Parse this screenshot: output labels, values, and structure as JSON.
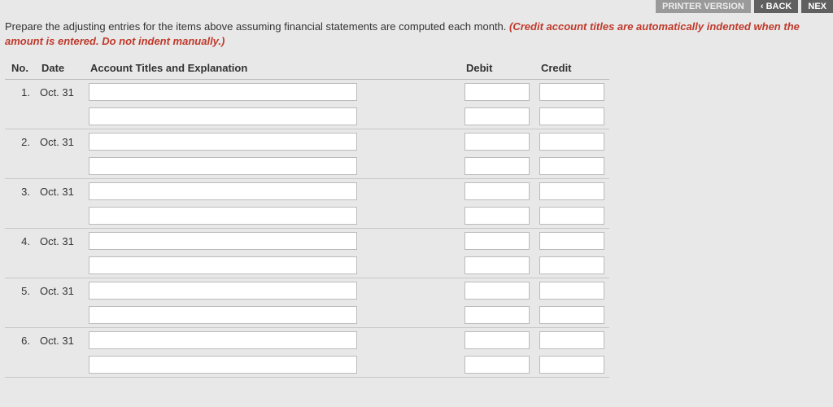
{
  "topbar": {
    "printer_label": "PRINTER VERSION",
    "back_label": "‹ BACK",
    "next_label": "NEX"
  },
  "instructions": {
    "plain": "Prepare the adjusting entries for the items above assuming financial statements are computed each month. ",
    "emph": "(Credit account titles are automatically indented when the amount is entered. Do not indent manually.)"
  },
  "headers": {
    "no": "No.",
    "date": "Date",
    "account": "Account Titles and Explanation",
    "debit": "Debit",
    "credit": "Credit"
  },
  "rows": [
    {
      "no": "1.",
      "date": "Oct. 31"
    },
    {
      "no": "2.",
      "date": "Oct. 31"
    },
    {
      "no": "3.",
      "date": "Oct. 31"
    },
    {
      "no": "4.",
      "date": "Oct. 31"
    },
    {
      "no": "5.",
      "date": "Oct. 31"
    },
    {
      "no": "6.",
      "date": "Oct. 31"
    }
  ]
}
